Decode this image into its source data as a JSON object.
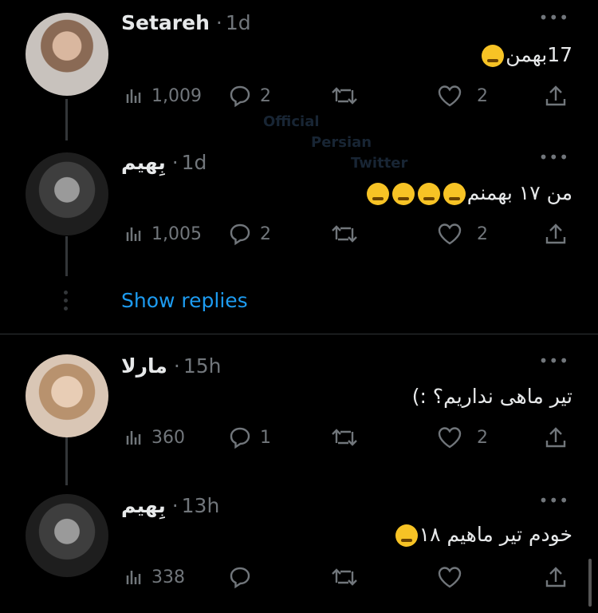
{
  "tweets": [
    {
      "name": "Setareh",
      "time": "1d",
      "text": "17بهمن",
      "views": "1,009",
      "replies": "2",
      "retweets": "",
      "likes": "2",
      "avatar_icon": "avatar-woman-photo"
    },
    {
      "name": "بِهیم",
      "time": "1d",
      "text": "من ۱۷ بهمنم",
      "views": "1,005",
      "replies": "2",
      "retweets": "",
      "likes": "2",
      "avatar_icon": "avatar-man-photo"
    },
    {
      "name": "مارلا",
      "time": "15h",
      "text": "تیر ماهی نداریم؟ :)",
      "views": "360",
      "replies": "1",
      "retweets": "",
      "likes": "2",
      "avatar_icon": "avatar-woman-photo"
    },
    {
      "name": "بِهیم",
      "time": "13h",
      "text": "خودم تیر ماهیم ۱۸",
      "views": "338",
      "replies": "",
      "retweets": "",
      "likes": "",
      "avatar_icon": "avatar-man-photo"
    }
  ],
  "show_replies": "Show replies",
  "separator": "·",
  "more_glyph": "•••",
  "watermark": {
    "line1": "Official",
    "line2": "Persian",
    "line3": "Twitter"
  },
  "colors": {
    "background": "#000000",
    "text": "#e7e9ea",
    "muted": "#71767b",
    "link": "#1d9bf0"
  }
}
